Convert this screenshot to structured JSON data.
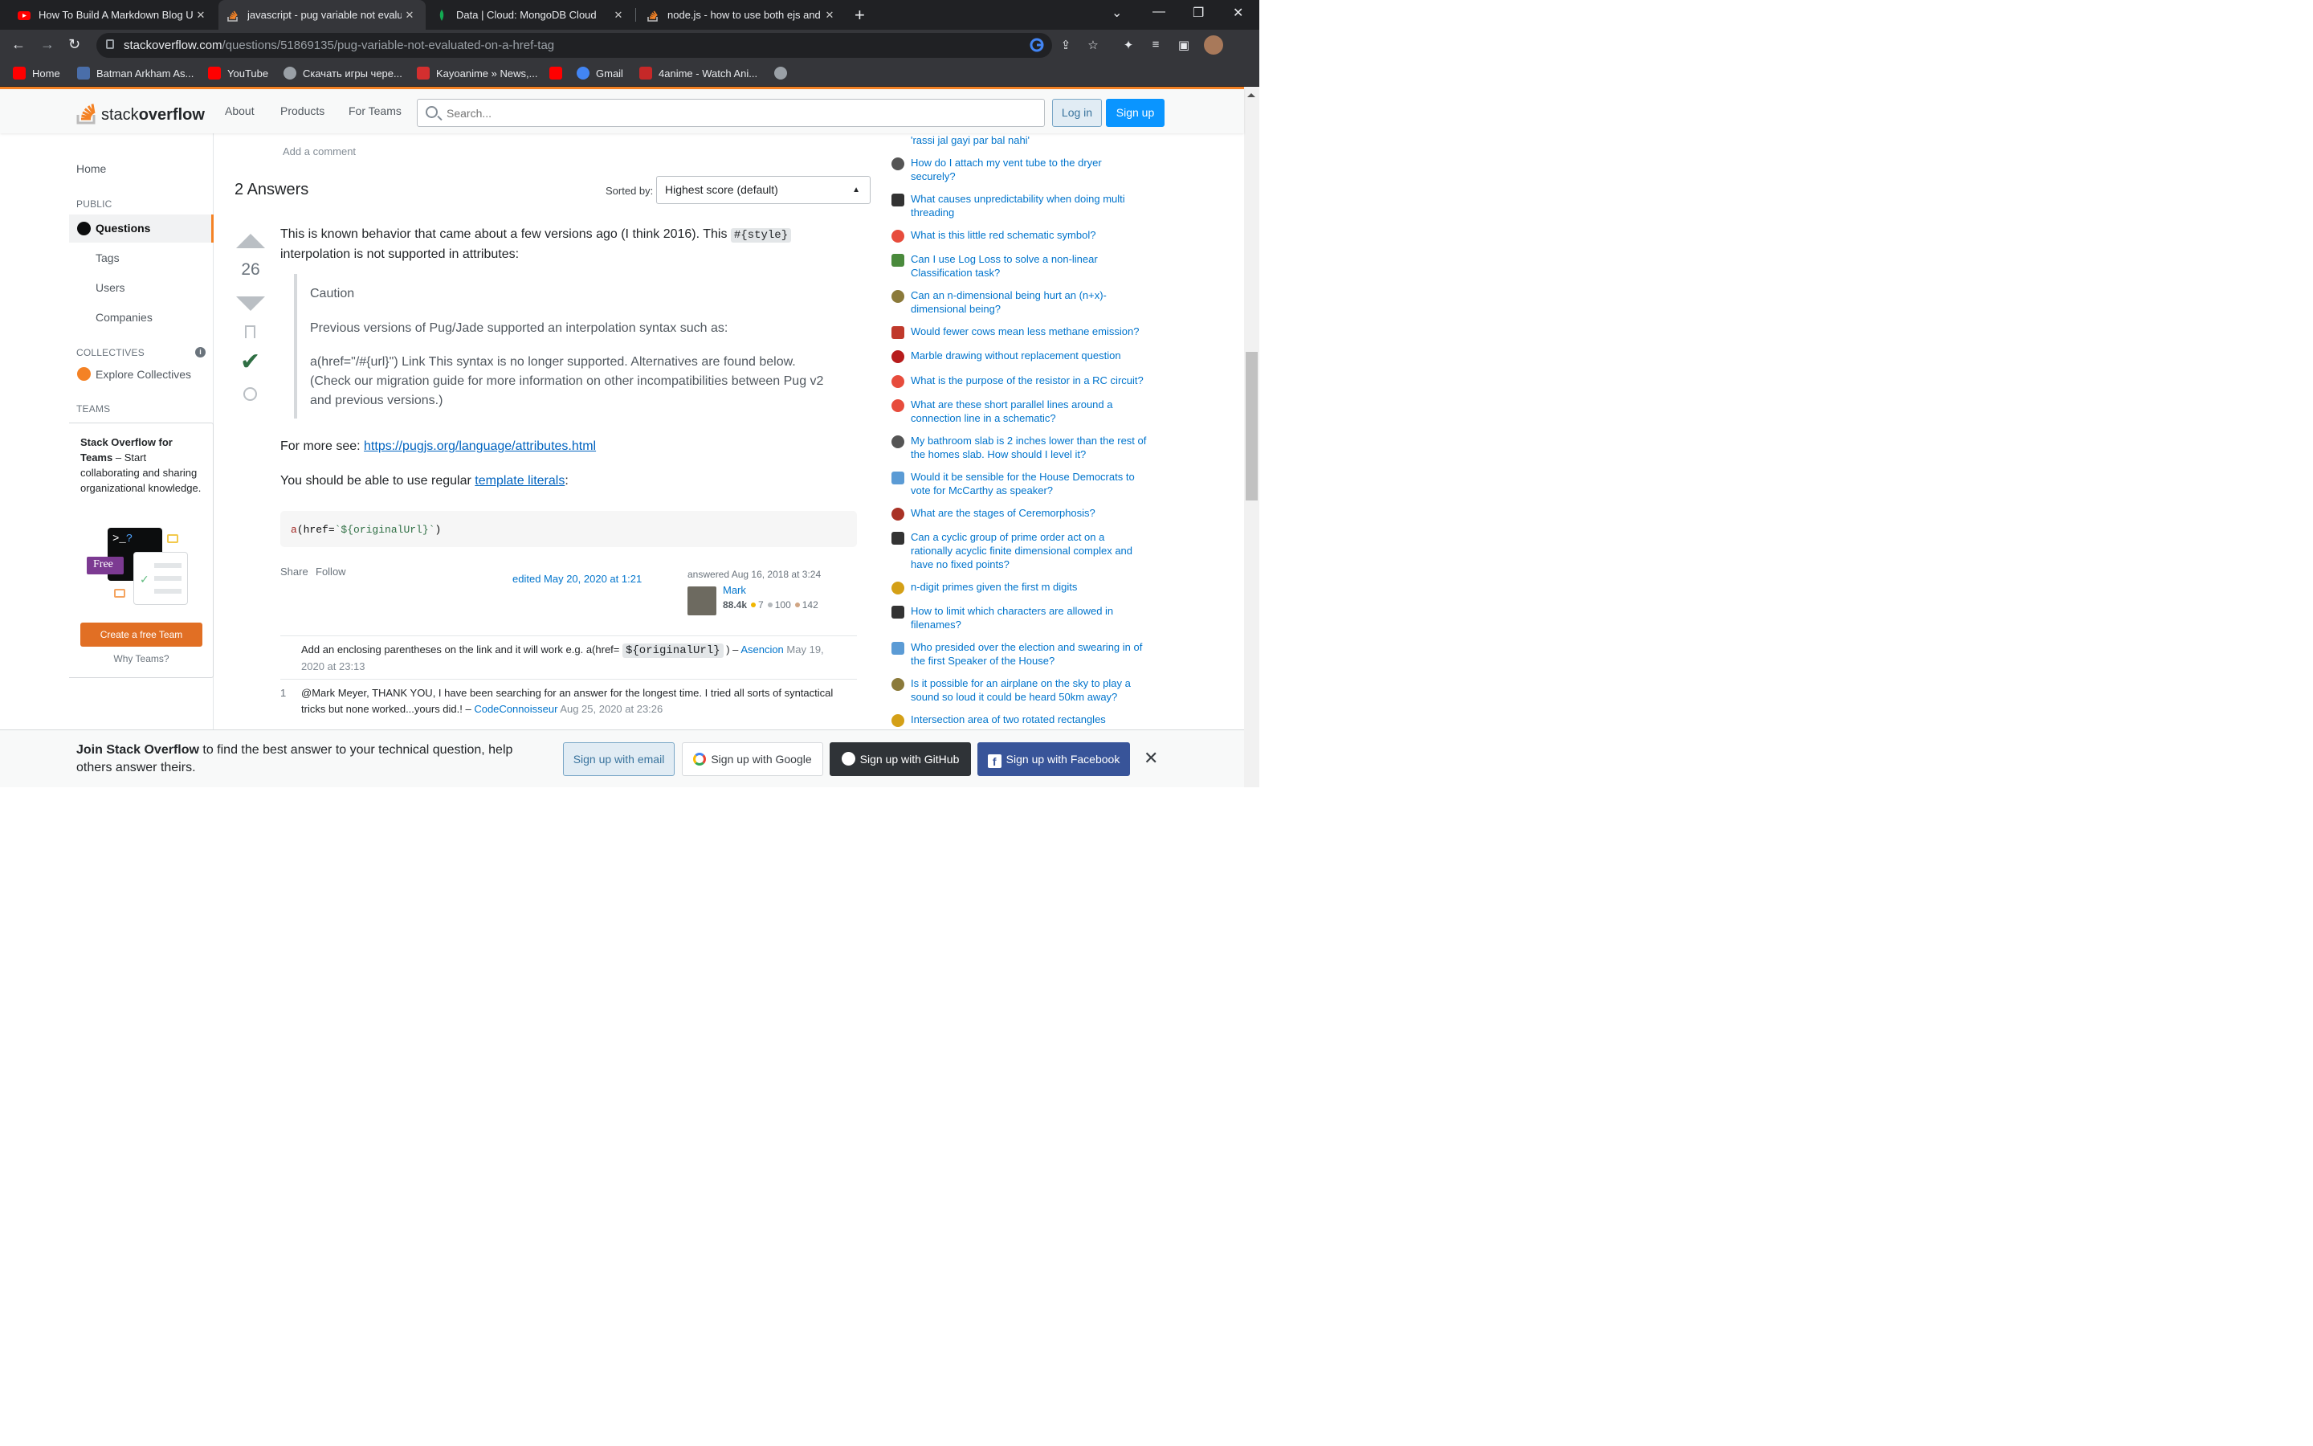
{
  "browser": {
    "tabs": [
      {
        "title": "How To Build A Markdown Blog U",
        "icon_color": "#ff0000",
        "icon": "youtube-icon"
      },
      {
        "title": "javascript - pug variable not evalu",
        "icon_color": "#f48225",
        "icon": "stackoverflow-icon"
      },
      {
        "title": "Data | Cloud: MongoDB Cloud",
        "icon_color": "#13aa52",
        "icon": "mongodb-icon"
      },
      {
        "title": "node.js - how to use both ejs and",
        "icon_color": "#f48225",
        "icon": "stackoverflow-icon"
      }
    ],
    "url_host": "stackoverflow.com",
    "url_path": "/questions/51869135/pug-variable-not-evaluated-on-a-href-tag",
    "bookmarks": [
      {
        "label": "Home",
        "color": "#ff0000"
      },
      {
        "label": "Batman Arkham As...",
        "color": "#4a6ea9"
      },
      {
        "label": "YouTube",
        "color": "#ff0000"
      },
      {
        "label": "Скачать игры чере...",
        "color": "#9aa0a6"
      },
      {
        "label": "Kayoanime » News,...",
        "color": "#d32f2f"
      },
      {
        "label": "",
        "color": "#ff0000"
      },
      {
        "label": "Gmail",
        "color": "#4285f4"
      },
      {
        "label": "4anime - Watch Ani...",
        "color": "#c62828"
      },
      {
        "label": "",
        "color": "#9aa0a6"
      }
    ]
  },
  "header": {
    "logo_plain": "stack",
    "logo_bold": "overflow",
    "nav": [
      "About",
      "Products",
      "For Teams"
    ],
    "search_placeholder": "Search...",
    "login": "Log in",
    "signup": "Sign up"
  },
  "leftnav": {
    "home": "Home",
    "public": "PUBLIC",
    "questions": "Questions",
    "tags": "Tags",
    "users": "Users",
    "companies": "Companies",
    "collectives": "COLLECTIVES",
    "explore": "Explore Collectives",
    "teams": "TEAMS",
    "teams_title": "Stack Overflow for Teams",
    "teams_desc": " – Start collaborating and sharing organizational knowledge.",
    "free_badge": "Free",
    "cta": "Create a free Team",
    "why": "Why Teams?"
  },
  "main": {
    "add_comment": "Add a comment",
    "answers_heading": "2 Answers",
    "sorted_by": "Sorted by:",
    "sort_value": "Highest score (default)",
    "answer": {
      "score": "26",
      "p1_a": "This is known behavior that came about a few versions ago (I think 2016). This ",
      "p1_code": "#{style}",
      "p1_b": " interpolation is not supported in attributes:",
      "quote_title": "Caution",
      "quote_p1": "Previous versions of Pug/Jade supported an interpolation syntax such as:",
      "quote_p2": "a(href=\"/#{url}\") Link This syntax is no longer supported. Alternatives are found below. (Check our migration guide for more information on other incompatibilities between Pug v2 and previous versions.)",
      "more_see": "For more see: ",
      "more_link": "https://pugjs.org/language/attributes.html",
      "regular_a": "You should be able to use regular ",
      "regular_link": "template literals",
      "regular_b": ":",
      "code_tag": "a",
      "code_mid": "(href=",
      "code_str": "`${originalUrl}`",
      "code_end": ")",
      "share": "Share",
      "follow": "Follow",
      "edited": "edited May 20, 2020 at 1:21",
      "answered": "answered Aug 16, 2018 at 3:24",
      "user": "Mark",
      "rep": "88.4k",
      "gold": "7",
      "silver": "100",
      "bronze": "142"
    },
    "comments": [
      {
        "score": "",
        "text_a": "Add an enclosing parentheses on the link and it will work e.g. a(href= ",
        "code": "${originalUrl}",
        "text_b": " ) – ",
        "user": "Asencion",
        "date": "May 19, 2020 at 23:13"
      },
      {
        "score": "1",
        "text_a": "@Mark Meyer, THANK YOU, I have been searching for an answer for the longest time. I tried all sorts of syntactical tricks but none worked...yours did.! – ",
        "code": "",
        "text_b": "",
        "user": "CodeConnoisseur",
        "date": "Aug 25, 2020 at 23:26"
      }
    ]
  },
  "hot_questions": [
    {
      "title": "'rassi jal gayi par bal nahi'",
      "color": "#6a737c"
    },
    {
      "title": "How do I attach my vent tube to the dryer securely?",
      "color": "#555"
    },
    {
      "title": "What causes unpredictability when doing multi threading",
      "color": "#333"
    },
    {
      "title": "What is this little red schematic symbol?",
      "color": "#e74c3c"
    },
    {
      "title": "Can I use Log Loss to solve a non-linear Classification task?",
      "color": "#4a8a3c"
    },
    {
      "title": "Can an n-dimensional being hurt an (n+x)-dimensional being?",
      "color": "#8b7a3a"
    },
    {
      "title": "Would fewer cows mean less methane emission?",
      "color": "#c0392b"
    },
    {
      "title": "Marble drawing without replacement question",
      "color": "#b71c1c"
    },
    {
      "title": "What is the purpose of the resistor in a RC circuit?",
      "color": "#e74c3c"
    },
    {
      "title": "What are these short parallel lines around a connection line in a schematic?",
      "color": "#e74c3c"
    },
    {
      "title": "My bathroom slab is 2 inches lower than the rest of the homes slab. How should I level it?",
      "color": "#555"
    },
    {
      "title": "Would it be sensible for the House Democrats to vote for McCarthy as speaker?",
      "color": "#5b9bd5"
    },
    {
      "title": "What are the stages of Ceremorphosis?",
      "color": "#a93226"
    },
    {
      "title": "Can a cyclic group of prime order act on a rationally acyclic finite dimensional complex and have no fixed points?",
      "color": "#333"
    },
    {
      "title": "n-digit primes given the first m digits",
      "color": "#d4a017"
    },
    {
      "title": "How to limit which characters are allowed in filenames?",
      "color": "#333"
    },
    {
      "title": "Who presided over the election and swearing in of the first Speaker of the House?",
      "color": "#5b9bd5"
    },
    {
      "title": "Is it possible for an airplane on the sky to play a sound so loud it could be heard 50km away?",
      "color": "#8b7a3a"
    },
    {
      "title": "Intersection area of two rotated rectangles",
      "color": "#d4a017"
    }
  ],
  "banner": {
    "bold": "Join Stack Overflow",
    "text": " to find the best answer to your technical question, help others answer theirs.",
    "email": "Sign up with email",
    "google": "Sign up with Google",
    "github": "Sign up with GitHub",
    "facebook": "Sign up with Facebook"
  }
}
